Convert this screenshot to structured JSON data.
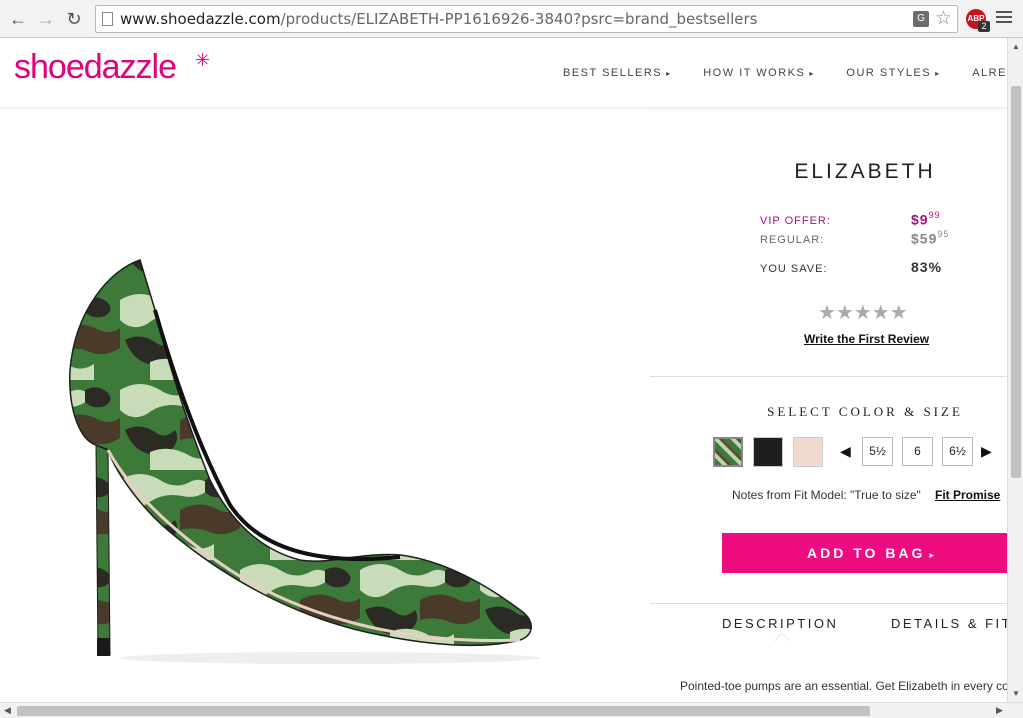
{
  "browser": {
    "url_host": "www.shoedazzle.com",
    "url_path": "/products/ELIZABETH-PP1616926-3840?psrc=brand_bestsellers",
    "back_icon": "back-arrow-icon",
    "forward_icon": "forward-arrow-icon",
    "reload_icon": "reload-icon",
    "abp_label": "ABP",
    "abp_count": "2"
  },
  "header": {
    "logo": "shoedazzle",
    "nav": [
      {
        "label": "BEST SELLERS"
      },
      {
        "label": "HOW IT WORKS"
      },
      {
        "label": "OUR STYLES"
      },
      {
        "label": "ALREADY A"
      }
    ]
  },
  "product": {
    "name": "ELIZABETH",
    "vip_label": "VIP OFFER:",
    "vip_price_main": "$9",
    "vip_price_cents": "99",
    "regular_label": "REGULAR:",
    "regular_price_main": "$59",
    "regular_price_cents": "95",
    "save_label": "YOU SAVE:",
    "save_value": "83%",
    "rating_stars": "★★★★★",
    "rating_value": 0,
    "write_review": "Write the First Review",
    "select_title": "SELECT COLOR & SIZE",
    "colors": [
      "camo",
      "black",
      "nude"
    ],
    "sizes": [
      "5½",
      "6",
      "6½"
    ],
    "fit_note": "Notes from Fit Model: \"True to size\"",
    "fit_promise": "Fit Promise",
    "add_to_bag": "ADD TO BAG",
    "tabs": [
      "DESCRIPTION",
      "DETAILS & FIT"
    ],
    "description": "Pointed-toe pumps are an essential. Get Elizabeth in every color."
  },
  "colors": {
    "brand_pink": "#e3007b",
    "button_pink": "#ef0c80",
    "vip_purple": "#a3127a"
  }
}
